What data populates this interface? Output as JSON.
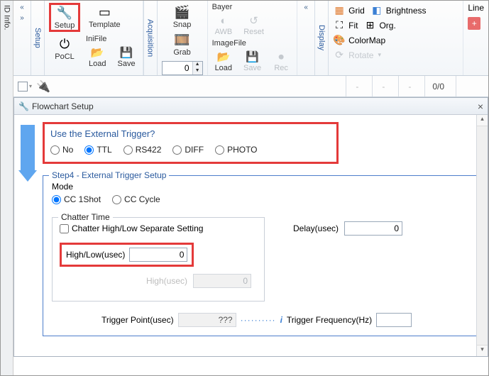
{
  "vertical_tabs": {
    "idinfo": "ID Info.",
    "setup": "Setup",
    "acquisition": "Acquisition",
    "display": "Display"
  },
  "ribbon": {
    "setup": {
      "setup_label": "Setup",
      "template_label": "Template",
      "pocl_label": "PoCL",
      "ini_header": "IniFile",
      "load_label": "Load",
      "save_label": "Save"
    },
    "acq": {
      "snap_label": "Snap",
      "grab_label": "Grab",
      "spinner_value": "0"
    },
    "bayer": {
      "header": "Bayer",
      "awb_label": "AWB",
      "reset_label": "Reset"
    },
    "imagefile": {
      "header": "ImageFile",
      "load_label": "Load",
      "save_label": "Save",
      "rec_label": "Rec"
    },
    "display": {
      "grid_label": "Grid",
      "bright_label": "Brightness",
      "fit_label": "Fit",
      "org_label": "Org.",
      "colormap_label": "ColorMap",
      "rotate_label": "Rotate",
      "line_label": "Line"
    }
  },
  "strip": {
    "dash": "-",
    "ratio": "0/0"
  },
  "dialog": {
    "title": "Flowchart Setup",
    "q": {
      "title": "Use the External Trigger?",
      "options": [
        "No",
        "TTL",
        "RS422",
        "DIFF",
        "PHOTO"
      ],
      "selected": "TTL"
    },
    "step4": {
      "legend": "Step4 - External Trigger Setup",
      "mode_label": "Mode",
      "mode_options": [
        "CC 1Shot",
        "CC Cycle"
      ],
      "mode_selected": "CC 1Shot",
      "chatter": {
        "legend": "Chatter Time",
        "sep_label": "Chatter High/Low Separate Setting",
        "hl_label": "High/Low(usec)",
        "hl_value": "0",
        "high_label": "High(usec)",
        "high_value": "0"
      },
      "delay_label": "Delay(usec)",
      "delay_value": "0",
      "tp_label": "Trigger Point(usec)",
      "tp_value": "???",
      "tf_label": "Trigger Frequency(Hz)",
      "tf_value": ""
    }
  }
}
